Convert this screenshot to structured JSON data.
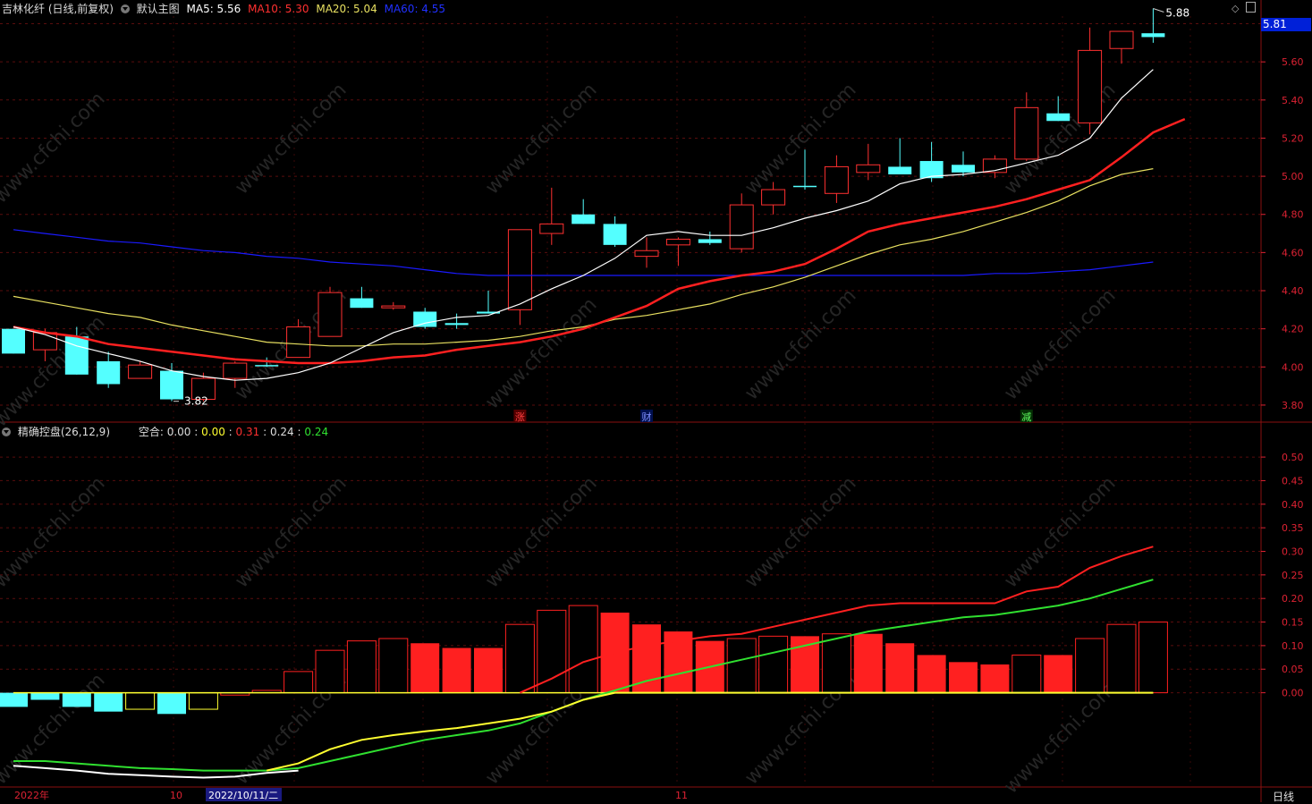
{
  "header": {
    "stock_label": "吉林化纤 (日线,前复权)",
    "main_chart_label": "默认主图",
    "ma5": "MA5: 5.56",
    "ma10": "MA10: 5.30",
    "ma20": "MA20: 5.04",
    "ma60": "MA60: 4.55"
  },
  "indicator_header": {
    "name": "精确控盘(26,12,9)",
    "short_label": "空合:",
    "v1": "0.00",
    "v2": "0.00",
    "v3": "0.31",
    "v4": "0.24",
    "v5": "0.24",
    "sep": ":"
  },
  "current_price": "5.81",
  "period": "日线",
  "annotations": {
    "high": "5.88",
    "low": "3.82",
    "event1": "涨",
    "event2": "财",
    "event3": "减"
  },
  "watermark": "www.cfchi.com",
  "colors": {
    "up": "#ff3030",
    "down": "#54ffff",
    "ma5": "#ffffff",
    "ma10": "#ff2020",
    "ma20": "#e8e060",
    "ma60": "#1a1aff",
    "ind_red": "#ff2020",
    "ind_green": "#30e030",
    "ind_yellow": "#ffff30",
    "ind_white": "#ffffff"
  },
  "x_axis": {
    "year": "2022年",
    "month10": "10",
    "cursor_date": "2022/10/11/二",
    "month11": "11"
  },
  "chart_data": [
    {
      "type": "candlestick",
      "y_axis_ticks": [
        "5.80",
        "5.60",
        "5.40",
        "5.20",
        "5.00",
        "4.80",
        "4.60",
        "4.40",
        "4.20",
        "4.00",
        "3.80"
      ],
      "ylim": [
        3.72,
        5.84
      ],
      "candles": [
        {
          "o": 4.2,
          "h": 4.2,
          "l": 4.07,
          "c": 4.07
        },
        {
          "o": 4.09,
          "h": 4.2,
          "l": 4.03,
          "c": 4.18
        },
        {
          "o": 4.16,
          "h": 4.21,
          "l": 3.96,
          "c": 3.96
        },
        {
          "o": 4.03,
          "h": 4.08,
          "l": 3.89,
          "c": 3.91
        },
        {
          "o": 3.94,
          "h": 4.03,
          "l": 3.94,
          "c": 4.01
        },
        {
          "o": 3.98,
          "h": 4.02,
          "l": 3.82,
          "c": 3.83
        },
        {
          "o": 3.83,
          "h": 3.97,
          "l": 3.82,
          "c": 3.94
        },
        {
          "o": 3.94,
          "h": 4.03,
          "l": 3.89,
          "c": 4.02
        },
        {
          "o": 4.01,
          "h": 4.05,
          "l": 4.0,
          "c": 4.01
        },
        {
          "o": 4.05,
          "h": 4.25,
          "l": 4.05,
          "c": 4.21
        },
        {
          "o": 4.16,
          "h": 4.42,
          "l": 4.16,
          "c": 4.39
        },
        {
          "o": 4.36,
          "h": 4.42,
          "l": 4.31,
          "c": 4.31
        },
        {
          "o": 4.31,
          "h": 4.34,
          "l": 4.3,
          "c": 4.32
        },
        {
          "o": 4.29,
          "h": 4.31,
          "l": 4.2,
          "c": 4.21
        },
        {
          "o": 4.23,
          "h": 4.28,
          "l": 4.2,
          "c": 4.22
        },
        {
          "o": 4.29,
          "h": 4.4,
          "l": 4.28,
          "c": 4.28
        },
        {
          "o": 4.3,
          "h": 4.72,
          "l": 4.22,
          "c": 4.72
        },
        {
          "o": 4.7,
          "h": 4.94,
          "l": 4.64,
          "c": 4.75
        },
        {
          "o": 4.8,
          "h": 4.88,
          "l": 4.75,
          "c": 4.75
        },
        {
          "o": 4.75,
          "h": 4.79,
          "l": 4.63,
          "c": 4.64
        },
        {
          "o": 4.58,
          "h": 4.68,
          "l": 4.52,
          "c": 4.61
        },
        {
          "o": 4.64,
          "h": 4.68,
          "l": 4.53,
          "c": 4.67
        },
        {
          "o": 4.67,
          "h": 4.71,
          "l": 4.64,
          "c": 4.65
        },
        {
          "o": 4.62,
          "h": 4.91,
          "l": 4.6,
          "c": 4.85
        },
        {
          "o": 4.85,
          "h": 4.97,
          "l": 4.8,
          "c": 4.93
        },
        {
          "o": 4.95,
          "h": 5.14,
          "l": 4.93,
          "c": 4.95
        },
        {
          "o": 4.91,
          "h": 5.11,
          "l": 4.86,
          "c": 5.05
        },
        {
          "o": 5.02,
          "h": 5.17,
          "l": 4.98,
          "c": 5.06
        },
        {
          "o": 5.05,
          "h": 5.2,
          "l": 5.03,
          "c": 5.01
        },
        {
          "o": 5.08,
          "h": 5.18,
          "l": 4.97,
          "c": 4.99
        },
        {
          "o": 5.06,
          "h": 5.13,
          "l": 5.0,
          "c": 5.02
        },
        {
          "o": 5.02,
          "h": 5.11,
          "l": 4.99,
          "c": 5.09
        },
        {
          "o": 5.09,
          "h": 5.44,
          "l": 5.08,
          "c": 5.36
        },
        {
          "o": 5.33,
          "h": 5.42,
          "l": 5.29,
          "c": 5.29
        },
        {
          "o": 5.28,
          "h": 5.78,
          "l": 5.22,
          "c": 5.66
        },
        {
          "o": 5.67,
          "h": 5.76,
          "l": 5.59,
          "c": 5.76
        },
        {
          "o": 5.75,
          "h": 5.88,
          "l": 5.7,
          "c": 5.73
        }
      ],
      "ma5": [
        4.21,
        4.17,
        4.11,
        4.07,
        4.03,
        3.98,
        3.95,
        3.93,
        3.94,
        3.97,
        4.02,
        4.1,
        4.18,
        4.23,
        4.26,
        4.27,
        4.33,
        4.41,
        4.48,
        4.57,
        4.69,
        4.71,
        4.69,
        4.69,
        4.73,
        4.78,
        4.82,
        4.87,
        4.96,
        5.0,
        5.01,
        5.03,
        5.07,
        5.11,
        5.2,
        5.41,
        5.56
      ],
      "ma10": [
        4.21,
        4.18,
        4.16,
        4.12,
        4.1,
        4.08,
        4.06,
        4.04,
        4.03,
        4.02,
        4.02,
        4.03,
        4.05,
        4.06,
        4.09,
        4.11,
        4.13,
        4.16,
        4.2,
        4.26,
        4.32,
        4.41,
        4.45,
        4.48,
        4.5,
        4.54,
        4.62,
        4.71,
        4.75,
        4.78,
        4.81,
        4.84,
        4.88,
        4.93,
        4.98,
        5.1,
        5.23,
        5.3
      ],
      "ma20": [
        4.37,
        4.34,
        4.31,
        4.28,
        4.26,
        4.22,
        4.19,
        4.16,
        4.13,
        4.12,
        4.11,
        4.11,
        4.12,
        4.12,
        4.13,
        4.14,
        4.16,
        4.19,
        4.21,
        4.25,
        4.27,
        4.3,
        4.33,
        4.38,
        4.42,
        4.47,
        4.53,
        4.59,
        4.64,
        4.67,
        4.71,
        4.76,
        4.81,
        4.87,
        4.95,
        5.01,
        5.04
      ],
      "ma60": [
        4.72,
        4.7,
        4.68,
        4.66,
        4.65,
        4.63,
        4.61,
        4.6,
        4.58,
        4.57,
        4.55,
        4.54,
        4.53,
        4.51,
        4.49,
        4.48,
        4.48,
        4.48,
        4.48,
        4.48,
        4.48,
        4.48,
        4.48,
        4.48,
        4.48,
        4.48,
        4.48,
        4.48,
        4.48,
        4.48,
        4.48,
        4.49,
        4.49,
        4.5,
        4.51,
        4.53,
        4.55
      ]
    },
    {
      "type": "bar",
      "y_axis_ticks": [
        "0.50",
        "0.45",
        "0.40",
        "0.35",
        "0.30",
        "0.25",
        "0.20",
        "0.15",
        "0.10",
        "0.05",
        "0.00"
      ],
      "ylim": [
        -0.2,
        0.54
      ],
      "bars": [
        {
          "v": -0.03,
          "style": "cyan"
        },
        {
          "v": -0.015,
          "style": "cyan"
        },
        {
          "v": -0.03,
          "style": "cyan"
        },
        {
          "v": -0.04,
          "style": "cyan"
        },
        {
          "v": -0.035,
          "style": "yellow_hollow"
        },
        {
          "v": -0.045,
          "style": "cyan"
        },
        {
          "v": -0.035,
          "style": "yellow_hollow"
        },
        {
          "v": -0.005,
          "style": "hollow"
        },
        {
          "v": 0.005,
          "style": "hollow"
        },
        {
          "v": 0.045,
          "style": "hollow"
        },
        {
          "v": 0.09,
          "style": "hollow"
        },
        {
          "v": 0.11,
          "style": "hollow"
        },
        {
          "v": 0.115,
          "style": "hollow"
        },
        {
          "v": 0.105,
          "style": "solid"
        },
        {
          "v": 0.095,
          "style": "solid"
        },
        {
          "v": 0.095,
          "style": "solid"
        },
        {
          "v": 0.145,
          "style": "hollow"
        },
        {
          "v": 0.175,
          "style": "hollow"
        },
        {
          "v": 0.185,
          "style": "hollow"
        },
        {
          "v": 0.17,
          "style": "solid"
        },
        {
          "v": 0.145,
          "style": "solid"
        },
        {
          "v": 0.13,
          "style": "solid"
        },
        {
          "v": 0.11,
          "style": "solid"
        },
        {
          "v": 0.115,
          "style": "hollow"
        },
        {
          "v": 0.12,
          "style": "hollow"
        },
        {
          "v": 0.12,
          "style": "solid"
        },
        {
          "v": 0.125,
          "style": "hollow"
        },
        {
          "v": 0.125,
          "style": "solid"
        },
        {
          "v": 0.105,
          "style": "solid"
        },
        {
          "v": 0.08,
          "style": "solid"
        },
        {
          "v": 0.065,
          "style": "solid"
        },
        {
          "v": 0.06,
          "style": "solid"
        },
        {
          "v": 0.08,
          "style": "hollow"
        },
        {
          "v": 0.08,
          "style": "solid"
        },
        {
          "v": 0.115,
          "style": "hollow"
        },
        {
          "v": 0.145,
          "style": "hollow"
        },
        {
          "v": 0.15,
          "style": "hollow"
        }
      ],
      "series": [
        {
          "role": "red",
          "values": [
            null,
            null,
            null,
            null,
            null,
            null,
            null,
            null,
            null,
            null,
            null,
            null,
            null,
            null,
            null,
            null,
            0.0,
            0.03,
            0.065,
            0.085,
            0.1,
            0.11,
            0.12,
            0.125,
            0.14,
            0.155,
            0.17,
            0.185,
            0.19,
            0.19,
            0.19,
            0.19,
            0.215,
            0.225,
            0.265,
            0.29,
            0.31
          ]
        },
        {
          "role": "green",
          "values": [
            -0.145,
            -0.145,
            -0.15,
            -0.155,
            -0.16,
            -0.162,
            -0.165,
            -0.165,
            -0.165,
            -0.16,
            -0.145,
            -0.13,
            -0.115,
            -0.1,
            -0.09,
            -0.08,
            -0.065,
            -0.04,
            -0.015,
            0.005,
            0.025,
            0.04,
            0.055,
            0.07,
            0.085,
            0.1,
            0.115,
            0.13,
            0.14,
            0.15,
            0.16,
            0.165,
            0.175,
            0.185,
            0.2,
            0.22,
            0.24
          ]
        },
        {
          "role": "yellow",
          "values": [
            null,
            null,
            null,
            null,
            null,
            null,
            null,
            null,
            -0.165,
            -0.15,
            -0.12,
            -0.1,
            -0.09,
            -0.082,
            -0.075,
            -0.065,
            -0.055,
            -0.04,
            -0.015,
            0.0,
            0.0,
            0.0,
            0.0,
            0.0,
            0.0,
            0.0,
            0.0,
            0.0,
            0.0,
            0.0,
            0.0,
            0.0,
            0.0,
            0.0,
            0.0,
            0.0,
            0.0
          ]
        },
        {
          "role": "white",
          "values": [
            -0.155,
            -0.16,
            -0.165,
            -0.172,
            -0.175,
            -0.178,
            -0.18,
            -0.178,
            -0.17,
            -0.165,
            null,
            null,
            null,
            null,
            null,
            null,
            null,
            null,
            null,
            null,
            null,
            null,
            null,
            null,
            null,
            null,
            null,
            null,
            null,
            null,
            null,
            null,
            null,
            null,
            null,
            null,
            null
          ]
        }
      ]
    }
  ]
}
